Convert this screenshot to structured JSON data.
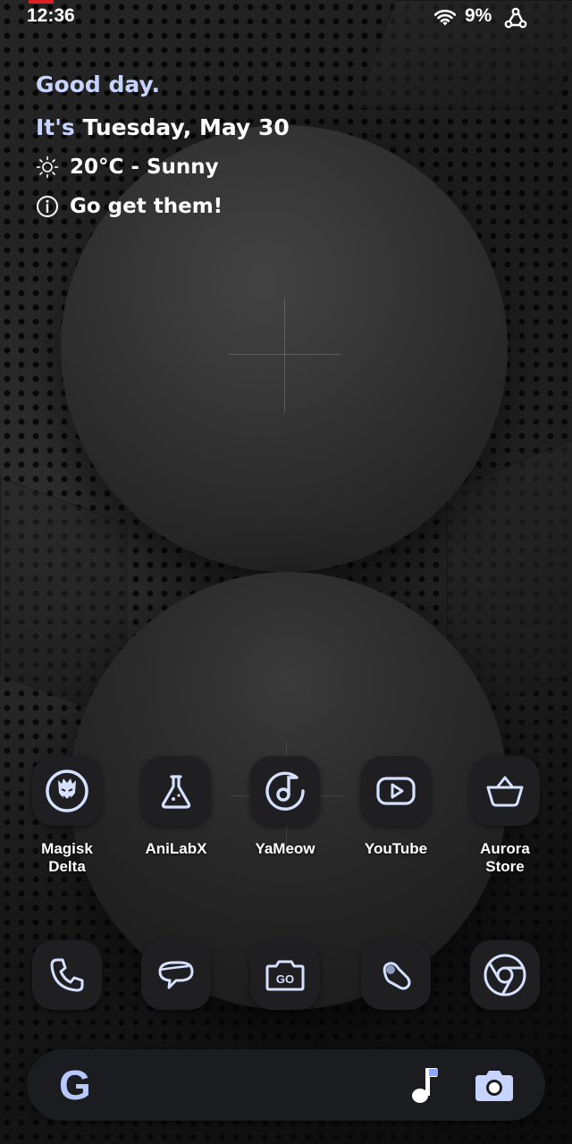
{
  "status_bar": {
    "time": "12:36",
    "battery": "9%",
    "icons": [
      "screen-record-indicator",
      "wifi-icon",
      "webhook-icon"
    ]
  },
  "glance": {
    "greeting": "Good day.",
    "date_prefix": "It's",
    "date": "Tuesday, May 30",
    "weather": "20°C - Sunny",
    "weather_icon": "sun-icon",
    "note": "Go get them!",
    "note_icon": "info-icon"
  },
  "apps": [
    {
      "label": "Magisk Delta",
      "icon": "magisk-mask-icon"
    },
    {
      "label": "AniLabX",
      "icon": "flask-icon"
    },
    {
      "label": "YaMeow",
      "icon": "music-disc-icon"
    },
    {
      "label": "YouTube",
      "icon": "youtube-play-icon"
    },
    {
      "label": "Aurora Store",
      "icon": "basket-icon"
    }
  ],
  "dock": [
    {
      "name": "phone",
      "icon": "phone-icon"
    },
    {
      "name": "messages",
      "icon": "chat-bubble-icon"
    },
    {
      "name": "camera-go",
      "icon": "camera-go-icon",
      "badge": "GO"
    },
    {
      "name": "assistant",
      "icon": "bean-icon"
    },
    {
      "name": "chrome",
      "icon": "chrome-icon"
    }
  ],
  "search_bar": {
    "logo": "G",
    "icons": [
      "google-g-icon",
      "music-note-icon",
      "lens-camera-icon"
    ]
  },
  "colors": {
    "accent": "#c6d4ff",
    "icon_stroke": "#d6e0ff",
    "tile_bg": "#1f1f22",
    "recording": "#e02020"
  }
}
